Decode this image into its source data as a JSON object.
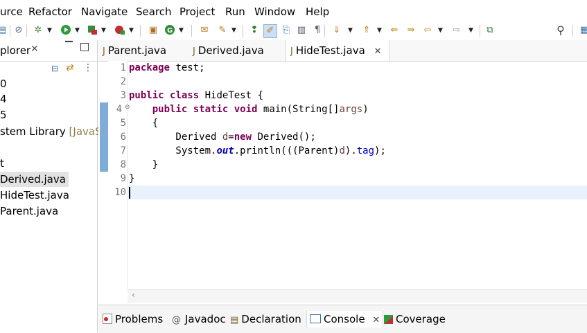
{
  "menubar": {
    "items": [
      "urce",
      "Refactor",
      "Navigate",
      "Search",
      "Project",
      "Run",
      "Window",
      "Help"
    ]
  },
  "toolbar": {
    "icons": [
      "save-icon",
      "debug-icon",
      "run-icon",
      "coverage-icon",
      "external-tools-icon",
      "new-package-icon",
      "new-class-icon",
      "open-type-icon",
      "search-icon",
      "toggle-breadcrumb-icon",
      "mark-occurrences-icon",
      "word-wrap-icon",
      "block-selection-icon",
      "show-whitespace-icon",
      "next-annotation-icon",
      "previous-annotation-icon",
      "last-edit-icon",
      "back-icon",
      "forward-icon",
      "pin-editor-icon"
    ],
    "quick_access_icon": "search-icon"
  },
  "explorer": {
    "tab_label": "plorer",
    "tree": [
      {
        "label": "0"
      },
      {
        "label": "4"
      },
      {
        "label": "5"
      },
      {
        "label": "stem Library",
        "suffix": "[JavaS"
      },
      {
        "label": ""
      },
      {
        "label": "t"
      },
      {
        "label": "Derived.java",
        "selected": true
      },
      {
        "label": "HideTest.java"
      },
      {
        "label": "Parent.java"
      }
    ]
  },
  "editor": {
    "tabs": [
      {
        "label": "Parent.java",
        "active": false
      },
      {
        "label": "Derived.java",
        "active": false
      },
      {
        "label": "HideTest.java",
        "active": true
      }
    ],
    "line_numbers": [
      "1",
      "2",
      "3",
      "4",
      "5",
      "6",
      "7",
      "8",
      "9",
      "10"
    ],
    "code": {
      "l1_kw": "package",
      "l1_rest": " test;",
      "l3_kw1": "public",
      "l3_kw2": "class",
      "l3_rest": " HideTest {",
      "l4_indent": "    ",
      "l4_kw1": "public",
      "l4_kw2": "static",
      "l4_kw3": "void",
      "l4_rest": " main(String[]",
      "l4_var": "args",
      "l4_end": ")",
      "l5": "    {",
      "l6_a": "        Derived ",
      "l6_var": "d",
      "l6_b": "=",
      "l6_kw": "new",
      "l6_c": " Derived();",
      "l7_a": "        System.",
      "l7_out": "out",
      "l7_b": ".println(((Parent)",
      "l7_var": "d",
      "l7_c": ").",
      "l7_fld": "tag",
      "l7_d": ");",
      "l8": "    }",
      "l9": "}"
    }
  },
  "bottom_panel": {
    "tabs": [
      {
        "label": "Problems",
        "icon": "problems-icon"
      },
      {
        "label": "Javadoc",
        "icon": "at-icon"
      },
      {
        "label": "Declaration",
        "icon": "declaration-icon"
      },
      {
        "label": "Console",
        "icon": "console-icon",
        "active": true
      },
      {
        "label": "Coverage",
        "icon": "coverage-icon"
      }
    ]
  },
  "colors": {
    "keyword": "#7f0055",
    "field": "#0000c0",
    "local_variable": "#6a3e3e",
    "line_number": "#787878",
    "current_line": "#e8f2fe",
    "selection": "#cce8ff"
  }
}
